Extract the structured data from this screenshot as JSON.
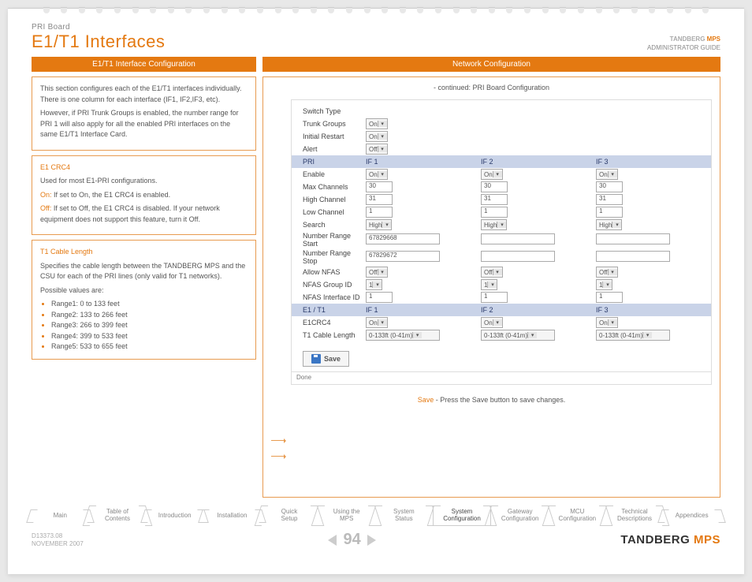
{
  "header": {
    "breadcrumb": "PRI Board",
    "title": "E1/T1 Interfaces",
    "brand": "TANDBERG",
    "brand_suffix": "MPS",
    "guide": "ADMINISTRATOR GUIDE"
  },
  "bars": {
    "left": "E1/T1 Interface Configuration",
    "right": "Network Configuration"
  },
  "intro": {
    "p1": "This section configures each of the E1/T1 interfaces individually. There is one column for each interface (IF1, IF2,IF3, etc).",
    "p2": "However, if PRI Trunk Groups is enabled, the number range for PRI 1 will also apply for all the enabled PRI interfaces on the same E1/T1 Interface Card."
  },
  "crc4": {
    "head": "E1 CRC4",
    "p1": "Used for most E1-PRI configurations.",
    "on_label": "On:",
    "on_text": " If set to On, the E1 CRC4 is enabled.",
    "off_label": "Off:",
    "off_text": " If set to Off, the E1 CRC4 is disabled. If your network equipment does not support this feature, turn it Off."
  },
  "cable": {
    "head": "T1 Cable Length",
    "p1": "Specifies the cable length between the TANDBERG MPS and the CSU for each of the PRI lines (only valid for T1 networks).",
    "p2": "Possible values are:",
    "ranges": [
      "Range1: 0 to 133 feet",
      "Range2: 133 to 266 feet",
      "Range3: 266 to 399 feet",
      "Range4: 399 to 533 feet",
      "Range5: 533 to 655 feet"
    ]
  },
  "right": {
    "continued": "- continued: PRI Board Configuration",
    "save_note_prefix": "Save",
    "save_note_rest": " - Press the Save button to save changes."
  },
  "form": {
    "top": [
      {
        "label": "Switch Type",
        "val": ""
      },
      {
        "label": "Trunk Groups",
        "val": "On"
      },
      {
        "label": "Initial Restart",
        "val": "On"
      },
      {
        "label": "Alert",
        "val": "Off"
      }
    ],
    "pri_hdr": {
      "lbl": "PRI",
      "c": [
        "IF 1",
        "IF 2",
        "IF 3"
      ]
    },
    "pri_rows": [
      {
        "label": "Enable",
        "type": "dd",
        "v": [
          "On",
          "On",
          "On"
        ]
      },
      {
        "label": "Max Channels",
        "type": "in",
        "v": [
          "30",
          "30",
          "30"
        ]
      },
      {
        "label": "High Channel",
        "type": "in",
        "v": [
          "31",
          "31",
          "31"
        ]
      },
      {
        "label": "Low Channel",
        "type": "in",
        "v": [
          "1",
          "1",
          "1"
        ]
      },
      {
        "label": "Search",
        "type": "dd",
        "v": [
          "High",
          "High",
          "High"
        ]
      },
      {
        "label": "Number Range Start",
        "type": "inw",
        "v": [
          "67829668",
          "",
          ""
        ]
      },
      {
        "label": "Number Range Stop",
        "type": "inw",
        "v": [
          "67829672",
          "",
          ""
        ]
      },
      {
        "label": "Allow NFAS",
        "type": "dd",
        "v": [
          "Off",
          "Off",
          "Off"
        ]
      },
      {
        "label": "NFAS Group ID",
        "type": "dd",
        "v": [
          "1",
          "1",
          "1"
        ]
      },
      {
        "label": "NFAS Interface ID",
        "type": "in",
        "v": [
          "1",
          "1",
          "1"
        ]
      }
    ],
    "e1_hdr": {
      "lbl": "E1 / T1",
      "c": [
        "IF 1",
        "IF 2",
        "IF 3"
      ]
    },
    "e1_rows": [
      {
        "label": "E1CRC4",
        "type": "dd",
        "v": [
          "On",
          "On",
          "On"
        ]
      },
      {
        "label": "T1 Cable Length",
        "type": "ddw",
        "v": [
          "0-133ft (0-41m)",
          "0-133ft (0-41m)",
          "0-133ft (0-41m)"
        ]
      }
    ],
    "save": "Save",
    "done": "Done"
  },
  "tabs": [
    "Main",
    "Table of Contents",
    "Introduction",
    "Installation",
    "Quick Setup",
    "Using the MPS",
    "System Status",
    "System Configuration",
    "Gateway Configuration",
    "MCU Configuration",
    "Technical Descriptions",
    "Appendices"
  ],
  "active_tab": 7,
  "footer": {
    "doc": "D13373.08",
    "date": "NOVEMBER 2007",
    "page": "94",
    "brand": "TANDBERG",
    "brand_suffix": "MPS"
  }
}
